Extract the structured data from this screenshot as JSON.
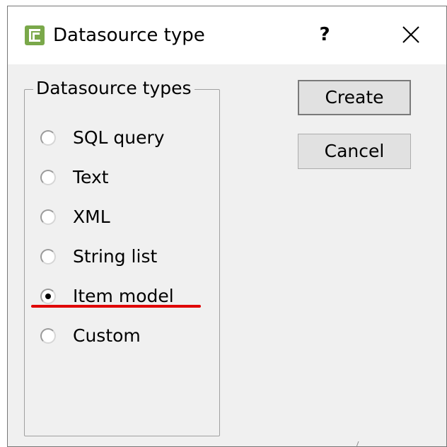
{
  "window": {
    "title": "Datasource type",
    "help_label": "?",
    "app_icon": "datasource-app-icon",
    "close_icon": "close-icon"
  },
  "group": {
    "label": "Datasource types",
    "options": [
      {
        "label": "SQL query",
        "checked": false
      },
      {
        "label": "Text",
        "checked": false
      },
      {
        "label": "XML",
        "checked": false
      },
      {
        "label": "String list",
        "checked": false
      },
      {
        "label": "Item model",
        "checked": true
      },
      {
        "label": "Custom",
        "checked": false
      }
    ]
  },
  "buttons": {
    "create_label": "Create",
    "cancel_label": "Cancel"
  },
  "colors": {
    "dialog_bg": "#f0f0f0",
    "title_bg": "#ffffff",
    "icon_green": "#7aa84a",
    "annotation_red": "#e00000"
  }
}
